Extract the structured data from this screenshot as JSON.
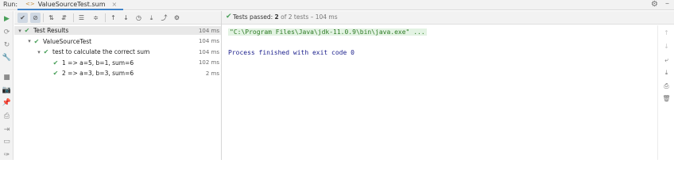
{
  "window": {
    "run_label": "Run:",
    "tab_title": "ValueSourceTest.sum",
    "tab_close": "×",
    "gear_icon": "⚙",
    "minimize_icon": "–"
  },
  "left_toolbar": [
    {
      "name": "rerun-icon",
      "glyph": "▶",
      "color": "#4aa05a"
    },
    {
      "name": "rerun-failed-icon",
      "glyph": "⟳"
    },
    {
      "name": "toggle-auto-test-icon",
      "glyph": "↻"
    },
    {
      "name": "settings-wrench-icon",
      "glyph": "🔧"
    },
    {
      "name": "stop-icon",
      "glyph": "■"
    },
    {
      "name": "screenshot-icon",
      "glyph": "📷"
    },
    {
      "name": "pin-icon",
      "glyph": "📌"
    },
    {
      "name": "print-icon",
      "glyph": "⎙"
    },
    {
      "name": "exit-icon",
      "glyph": "⇥"
    },
    {
      "name": "layout-icon",
      "glyph": "▭"
    },
    {
      "name": "pin-tab-icon",
      "glyph": "✑"
    }
  ],
  "tree_toolbar": [
    {
      "name": "show-passed-icon",
      "glyph": "✔",
      "on": true
    },
    {
      "name": "show-ignored-icon",
      "glyph": "⊘",
      "on": true
    },
    {
      "name": "sort-alpha-icon",
      "glyph": "⇅"
    },
    {
      "name": "sort-duration-icon",
      "glyph": "⇵"
    },
    {
      "name": "expand-all-icon",
      "glyph": "☰"
    },
    {
      "name": "collapse-all-icon",
      "glyph": "≑"
    },
    {
      "name": "prev-failed-icon",
      "glyph": "↑"
    },
    {
      "name": "next-failed-icon",
      "glyph": "↓"
    },
    {
      "name": "history-icon",
      "glyph": "◷"
    },
    {
      "name": "import-tests-icon",
      "glyph": "⤓"
    },
    {
      "name": "export-icon",
      "glyph": "⤴"
    },
    {
      "name": "test-settings-icon",
      "glyph": "⚙"
    }
  ],
  "status": {
    "check_icon": "✔",
    "label": "Tests passed:",
    "count": "2",
    "rest": "of 2 tests – 104 ms"
  },
  "tree": [
    {
      "level": 0,
      "arrow": "▾",
      "label": "Test Results",
      "time": "104 ms",
      "selected": true
    },
    {
      "level": 1,
      "arrow": "▾",
      "label": "ValueSourceTest",
      "time": "104 ms"
    },
    {
      "level": 2,
      "arrow": "▾",
      "label": "test to calculate the correct sum",
      "time": "104 ms"
    },
    {
      "level": 3,
      "arrow": "",
      "label": "1 => a=5, b=1, sum=6",
      "time": "102 ms"
    },
    {
      "level": 3,
      "arrow": "",
      "label": "2 => a=3, b=3, sum=6",
      "time": "2 ms"
    }
  ],
  "console": {
    "command": "\"C:\\Program Files\\Java\\jdk-11.0.9\\bin\\java.exe\" ...",
    "exit_line": "Process finished with exit code 0"
  },
  "right_toolbar": [
    {
      "name": "scroll-up-icon",
      "glyph": "↑",
      "disabled": true
    },
    {
      "name": "scroll-down-icon",
      "glyph": "↓",
      "disabled": true
    },
    {
      "name": "soft-wrap-icon",
      "glyph": "⤶"
    },
    {
      "name": "scroll-to-end-icon",
      "glyph": "⤓"
    },
    {
      "name": "print-console-icon",
      "glyph": "⎙"
    },
    {
      "name": "clear-all-icon",
      "glyph": "🗑"
    }
  ]
}
